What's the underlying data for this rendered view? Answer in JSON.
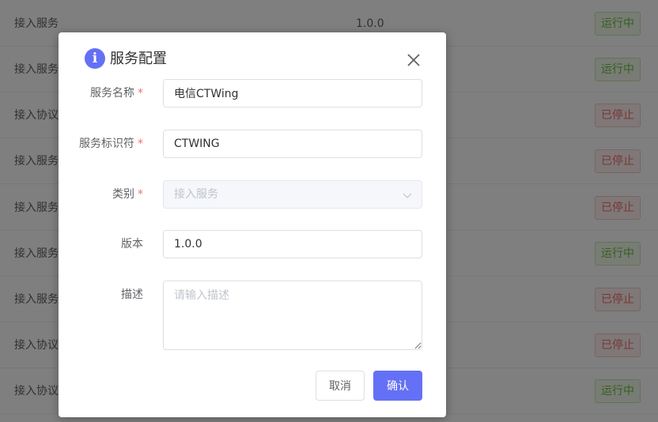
{
  "background": {
    "rows": [
      {
        "name": "接入服务",
        "version": "1.0.0",
        "status": "运行中",
        "kind": "running"
      },
      {
        "name": "接入服务",
        "version": "",
        "status": "运行中",
        "kind": "running"
      },
      {
        "name": "接入协议",
        "version": "",
        "status": "已停止",
        "kind": "stopped"
      },
      {
        "name": "接入服务",
        "version": "",
        "status": "已停止",
        "kind": "stopped"
      },
      {
        "name": "接入服务",
        "version": "",
        "status": "已停止",
        "kind": "stopped"
      },
      {
        "name": "接入服务",
        "version": "",
        "status": "运行中",
        "kind": "running"
      },
      {
        "name": "接入服务",
        "version": "",
        "status": "已停止",
        "kind": "stopped"
      },
      {
        "name": "接入协议",
        "version": "",
        "status": "已停止",
        "kind": "stopped"
      },
      {
        "name": "接入协议",
        "version": "",
        "status": "运行中",
        "kind": "running"
      }
    ]
  },
  "dialog": {
    "icon": "info-icon",
    "icon_glyph": "i",
    "title": "服务配置",
    "form": {
      "service_name": {
        "label": "服务名称",
        "required": "*",
        "value": "电信CTWing"
      },
      "service_id": {
        "label": "服务标识符",
        "required": "*",
        "value": "CTWING"
      },
      "category": {
        "label": "类别",
        "required": "*",
        "value": "接入服务"
      },
      "version": {
        "label": "版本",
        "value": "1.0.0"
      },
      "description": {
        "label": "描述",
        "placeholder": "请输入描述",
        "value": ""
      }
    },
    "buttons": {
      "cancel": "取消",
      "confirm": "确认"
    }
  },
  "colors": {
    "primary": "#6470f5",
    "running": "#67c23a",
    "stopped": "#f56c6c",
    "required": "#f56c6c"
  }
}
